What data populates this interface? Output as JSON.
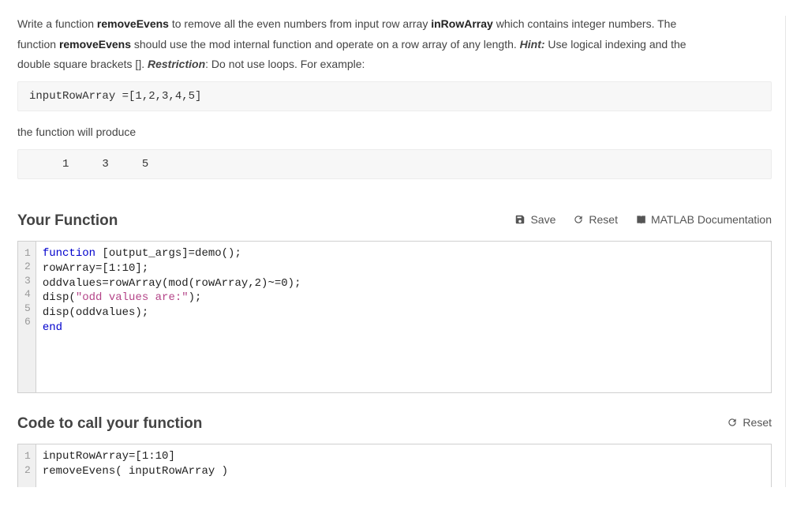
{
  "prompt": {
    "p1_a": "Write a function ",
    "p1_b": "removeEvens",
    "p1_c": " to remove all the even numbers from input row array ",
    "p1_d": "inRowArray",
    "p1_e": " which contains integer numbers.    The",
    "p2_a": "function ",
    "p2_b": "removeEvens",
    "p2_c": " should use the mod internal function and operate on a row array of any length.  ",
    "p2_d": "Hint:",
    "p2_e": " Use logical indexing and the",
    "p3_a": "double square brackets [].  ",
    "p3_b": "Restriction",
    "p3_c": ":  Do not use loops.  For example:"
  },
  "example_code": "inputRowArray =[1,2,3,4,5]",
  "example_after": "the function will produce",
  "example_output": "     1     3     5",
  "your_function": {
    "title": "Your Function",
    "save": "Save",
    "reset": "Reset",
    "docs": "MATLAB Documentation",
    "lines": [
      {
        "n": "1",
        "tokens": [
          {
            "cls": "kw",
            "t": "function"
          },
          {
            "cls": "plain",
            "t": " [output_args]=demo();"
          }
        ]
      },
      {
        "n": "2",
        "tokens": [
          {
            "cls": "plain",
            "t": "rowArray=[1:10];"
          }
        ]
      },
      {
        "n": "3",
        "tokens": [
          {
            "cls": "plain",
            "t": "oddvalues=rowArray(mod(rowArray,2)~=0);"
          }
        ]
      },
      {
        "n": "4",
        "tokens": [
          {
            "cls": "plain",
            "t": "disp("
          },
          {
            "cls": "str",
            "t": "\"odd values are:\""
          },
          {
            "cls": "plain",
            "t": ");"
          }
        ]
      },
      {
        "n": "5",
        "tokens": [
          {
            "cls": "plain",
            "t": "disp(oddvalues);"
          }
        ]
      },
      {
        "n": "6",
        "tokens": [
          {
            "cls": "kw",
            "t": "end"
          }
        ]
      }
    ]
  },
  "call_function": {
    "title": "Code to call your function",
    "reset": "Reset",
    "lines": [
      {
        "n": "1",
        "tokens": [
          {
            "cls": "plain",
            "t": "inputRowArray=[1:10]"
          }
        ]
      },
      {
        "n": "2",
        "tokens": [
          {
            "cls": "plain",
            "t": "removeEvens( inputRowArray )"
          }
        ]
      }
    ]
  }
}
